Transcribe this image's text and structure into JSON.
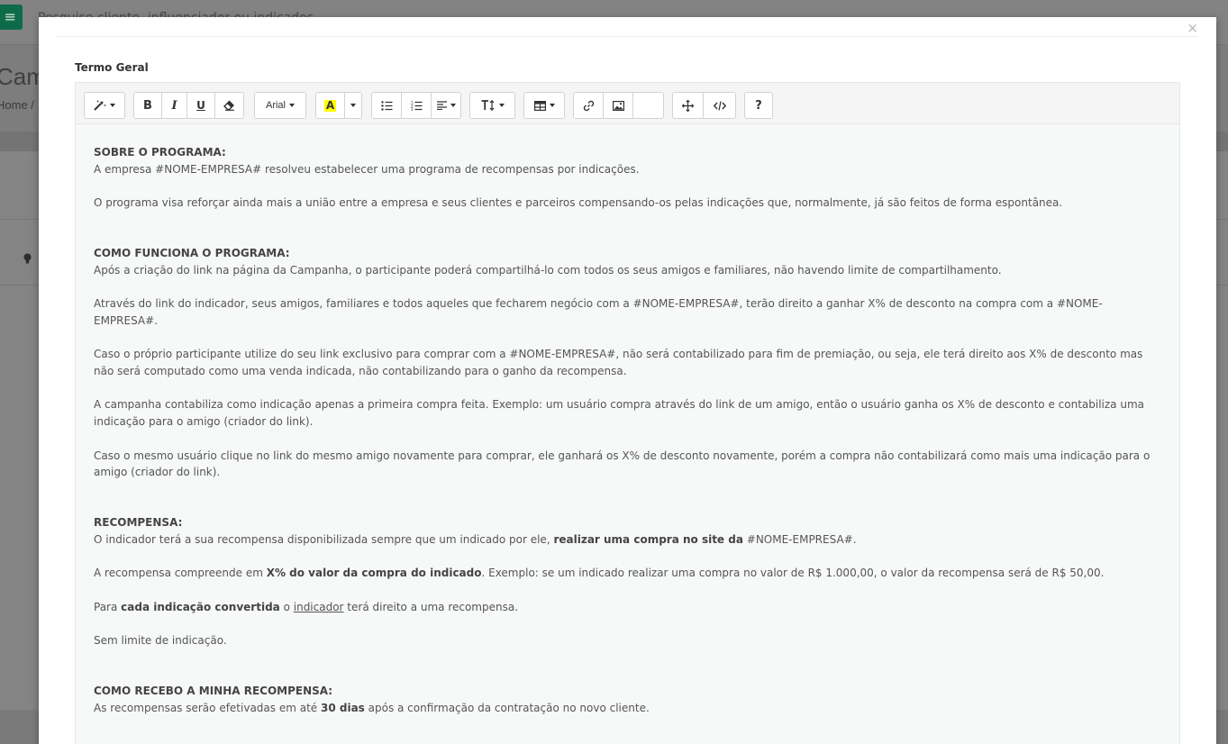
{
  "background": {
    "search_text": "Pesquise cliente, influenciador ou indicados",
    "page_title": "Campanha",
    "breadcrumb": "Home /"
  },
  "modal": {
    "close_label": "×",
    "field_label": "Termo Geral"
  },
  "toolbar": {
    "font_name": "Arial",
    "highlight_letter": "A",
    "help_label": "?",
    "highlight_color": "#ffff00"
  },
  "document": {
    "sec1_title": "SOBRE O PROGRAMA:",
    "sec1_p1": "A empresa #NOME-EMPRESA# resolveu estabelecer uma programa de recompensas por indicações.",
    "sec1_p2": "O programa visa reforçar ainda mais a união entre a empresa e seus clientes e parceiros compensando-os pelas indicações que, normalmente, já são feitos de forma espontânea.",
    "sec2_title": "COMO FUNCIONA O PROGRAMA:",
    "sec2_p1": "Após a criação do link na página da Campanha, o participante poderá compartilhá-lo com todos os seus amigos e familiares, não havendo limite de compartilhamento.",
    "sec2_p2": "Através do link do indicador, seus amigos, familiares e todos aqueles que fecharem negócio com a #NOME-EMPRESA#, terão direito a ganhar X% de desconto na compra com a #NOME-EMPRESA#.",
    "sec2_p3": "Caso o próprio participante utilize do seu link exclusivo para comprar com a #NOME-EMPRESA#, não será contabilizado para fim de premiação, ou seja, ele terá direito aos X% de desconto mas não será computado como uma venda indicada, não contabilizando para o ganho da recompensa.",
    "sec2_p4": "A campanha contabiliza como indicação apenas a primeira compra feita. Exemplo: um usuário compra através do link de um amigo, então o usuário ganha os X% de desconto e contabiliza uma indicação para o amigo (criador do link).",
    "sec2_p5": "Caso o mesmo usuário clique no link do mesmo amigo novamente para comprar, ele ganhará os X% de desconto novamente, porém a compra não contabilizará como mais uma indicação para o amigo (criador do link).",
    "sec3_title": "RECOMPENSA:",
    "sec3_p1_a": "O indicador terá a sua recompensa disponibilizada sempre que um indicado por ele, ",
    "sec3_p1_b": "realizar uma compra no site da",
    "sec3_p1_c": " #NOME-EMPRESA#.",
    "sec3_p2_a": "A recompensa compreende em ",
    "sec3_p2_b": "X% do valor da compra do indicado",
    "sec3_p2_c": ". Exemplo: se um indicado realizar uma compra no valor de R$ 1.000,00, o valor da recompensa será de R$ 50,00.",
    "sec3_p3_a": "Para ",
    "sec3_p3_b": "cada indicação convertida",
    "sec3_p3_c": " o ",
    "sec3_p3_d": "indicador",
    "sec3_p3_e": " terá direito a uma recompensa.",
    "sec3_p4": "Sem limite de indicação.",
    "sec4_title": "COMO RECEBO A MINHA RECOMPENSA:",
    "sec4_p1_a": "As recompensas serão efetivadas em até ",
    "sec4_p1_b": "30 dias",
    "sec4_p1_c": " após a confirmação da contratação no novo cliente."
  }
}
